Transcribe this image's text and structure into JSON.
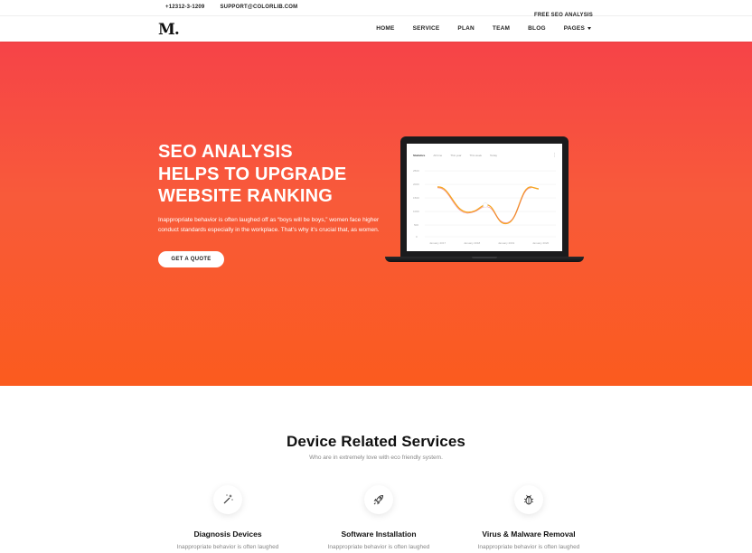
{
  "topbar": {
    "phone": "+12312-3-1209",
    "email": "SUPPORT@COLORLIB.COM",
    "right_link": "FREE SEO ANALYSIS"
  },
  "nav": {
    "logo": "M.",
    "items": [
      "HOME",
      "SERVICE",
      "PLAN",
      "TEAM",
      "BLOG",
      "PAGES"
    ]
  },
  "hero": {
    "title_lines": [
      "SEO ANALYSIS",
      "HELPS TO UPGRADE",
      "WEBSITE RANKING"
    ],
    "text": "Inappropriate behavior is often laughed off as “boys will be boys,” women face higher conduct standards especially in the workplace. That’s why it’s crucial that, as women.",
    "button": "GET A QUOTE",
    "colors": {
      "top": "#f64348",
      "bottom": "#fb5b1e"
    }
  },
  "laptop_screen": {
    "tabs": [
      "Statistics",
      "All time",
      "This year",
      "This week",
      "Today"
    ],
    "menu_icon": "more-vertical-icon",
    "y_ticks": [
      "2500",
      "2000",
      "1500",
      "1000",
      "500",
      "0"
    ],
    "x_labels": [
      "January 2017",
      "January 2018",
      "January 2019",
      "January 2020"
    ],
    "line_colors": [
      "#f6a623",
      "#e94a6a"
    ]
  },
  "services": {
    "title": "Device Related Services",
    "subtitle": "Who are in extremely love with eco friendly system.",
    "items": [
      {
        "icon": "magic-wand-icon",
        "name": "Diagnosis Devices",
        "desc": "Inappropriate behavior is often laughed"
      },
      {
        "icon": "rocket-icon",
        "name": "Software Installation",
        "desc": "Inappropriate behavior is often laughed"
      },
      {
        "icon": "bug-icon",
        "name": "Virus & Malware Removal",
        "desc": "Inappropriate behavior is often laughed"
      }
    ]
  }
}
